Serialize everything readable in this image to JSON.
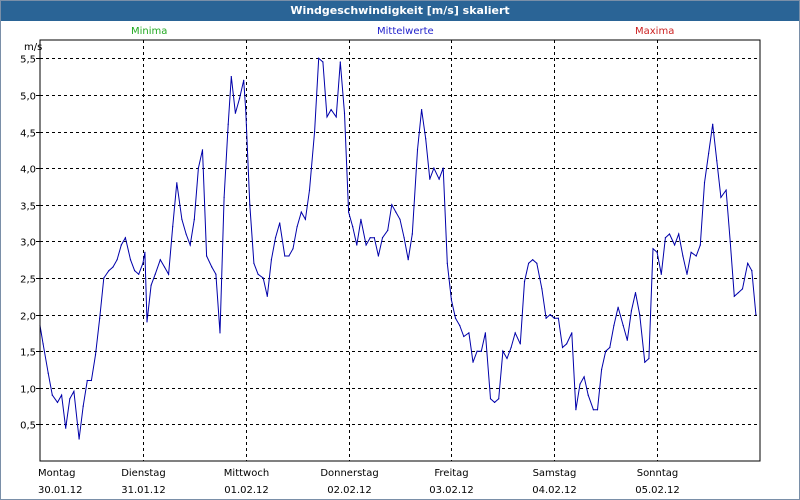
{
  "window": {
    "title": "Windgeschwindigkeit [m/s] skaliert"
  },
  "legend": {
    "minima": "Minima",
    "mittelwerte": "Mittelwerte",
    "maxima": "Maxima"
  },
  "colors": {
    "title_bar": "#2a6496",
    "minima": "#22aa22",
    "mittelwerte": "#2222cc",
    "maxima": "#cc2222",
    "series_line": "#0000aa",
    "grid": "#000000"
  },
  "chart_data": {
    "type": "line",
    "title": "Windgeschwindigkeit [m/s] skaliert",
    "ylabel": "m/s",
    "ylim": [
      0,
      5.75
    ],
    "yticks": [
      "0,5",
      "1,0",
      "1,5",
      "2,0",
      "2,5",
      "3,0",
      "3,5",
      "4,0",
      "4,5",
      "5,0",
      "5,5"
    ],
    "ytick_values": [
      0.5,
      1.0,
      1.5,
      2.0,
      2.5,
      3.0,
      3.5,
      4.0,
      4.5,
      5.0,
      5.5
    ],
    "xlim": [
      0,
      7
    ],
    "days": [
      {
        "weekday": "Montag",
        "date": "30.01.12"
      },
      {
        "weekday": "Dienstag",
        "date": "31.01.12"
      },
      {
        "weekday": "Mittwoch",
        "date": "01.02.12"
      },
      {
        "weekday": "Donnerstag",
        "date": "02.02.12"
      },
      {
        "weekday": "Freitag",
        "date": "03.02.12"
      },
      {
        "weekday": "Samstag",
        "date": "04.02.12"
      },
      {
        "weekday": "Sonntag",
        "date": "05.02.12"
      }
    ],
    "grid": true,
    "grid_style": "dashed",
    "series": [
      {
        "name": "Mittelwerte",
        "color": "#0000aa",
        "x_unit": "days since 30.01.12 00:00",
        "points": [
          [
            0.0,
            1.85
          ],
          [
            0.03,
            1.6
          ],
          [
            0.08,
            1.2
          ],
          [
            0.12,
            0.9
          ],
          [
            0.17,
            0.8
          ],
          [
            0.21,
            0.9
          ],
          [
            0.25,
            0.45
          ],
          [
            0.29,
            0.85
          ],
          [
            0.33,
            0.95
          ],
          [
            0.38,
            0.3
          ],
          [
            0.42,
            0.75
          ],
          [
            0.46,
            1.1
          ],
          [
            0.5,
            1.1
          ],
          [
            0.54,
            1.45
          ],
          [
            0.58,
            1.95
          ],
          [
            0.62,
            2.5
          ],
          [
            0.67,
            2.6
          ],
          [
            0.71,
            2.65
          ],
          [
            0.75,
            2.75
          ],
          [
            0.79,
            2.95
          ],
          [
            0.83,
            3.05
          ],
          [
            0.88,
            2.75
          ],
          [
            0.92,
            2.6
          ],
          [
            0.96,
            2.55
          ],
          [
            1.0,
            2.7
          ],
          [
            1.02,
            2.85
          ],
          [
            1.04,
            1.9
          ],
          [
            1.08,
            2.4
          ],
          [
            1.12,
            2.55
          ],
          [
            1.17,
            2.75
          ],
          [
            1.21,
            2.65
          ],
          [
            1.25,
            2.55
          ],
          [
            1.29,
            3.2
          ],
          [
            1.33,
            3.8
          ],
          [
            1.38,
            3.3
          ],
          [
            1.42,
            3.1
          ],
          [
            1.46,
            2.95
          ],
          [
            1.5,
            3.3
          ],
          [
            1.54,
            4.0
          ],
          [
            1.58,
            4.25
          ],
          [
            1.62,
            2.8
          ],
          [
            1.67,
            2.65
          ],
          [
            1.71,
            2.55
          ],
          [
            1.75,
            1.75
          ],
          [
            1.79,
            3.6
          ],
          [
            1.83,
            4.6
          ],
          [
            1.86,
            5.25
          ],
          [
            1.9,
            4.75
          ],
          [
            1.94,
            4.95
          ],
          [
            1.98,
            5.2
          ],
          [
            2.0,
            4.8
          ],
          [
            2.04,
            3.5
          ],
          [
            2.08,
            2.7
          ],
          [
            2.12,
            2.55
          ],
          [
            2.17,
            2.5
          ],
          [
            2.21,
            2.25
          ],
          [
            2.25,
            2.75
          ],
          [
            2.29,
            3.05
          ],
          [
            2.33,
            3.25
          ],
          [
            2.38,
            2.8
          ],
          [
            2.42,
            2.8
          ],
          [
            2.46,
            2.9
          ],
          [
            2.5,
            3.2
          ],
          [
            2.54,
            3.4
          ],
          [
            2.58,
            3.3
          ],
          [
            2.62,
            3.7
          ],
          [
            2.67,
            4.5
          ],
          [
            2.71,
            5.5
          ],
          [
            2.75,
            5.45
          ],
          [
            2.79,
            4.7
          ],
          [
            2.83,
            4.8
          ],
          [
            2.88,
            4.7
          ],
          [
            2.92,
            5.45
          ],
          [
            2.96,
            4.75
          ],
          [
            3.0,
            3.4
          ],
          [
            3.04,
            3.2
          ],
          [
            3.08,
            2.95
          ],
          [
            3.12,
            3.3
          ],
          [
            3.17,
            2.95
          ],
          [
            3.21,
            3.05
          ],
          [
            3.25,
            3.05
          ],
          [
            3.29,
            2.8
          ],
          [
            3.33,
            3.05
          ],
          [
            3.38,
            3.15
          ],
          [
            3.42,
            3.5
          ],
          [
            3.46,
            3.4
          ],
          [
            3.5,
            3.3
          ],
          [
            3.54,
            3.05
          ],
          [
            3.58,
            2.75
          ],
          [
            3.62,
            3.1
          ],
          [
            3.67,
            4.25
          ],
          [
            3.71,
            4.8
          ],
          [
            3.75,
            4.4
          ],
          [
            3.79,
            3.85
          ],
          [
            3.83,
            4.0
          ],
          [
            3.88,
            3.85
          ],
          [
            3.92,
            4.0
          ],
          [
            3.96,
            2.7
          ],
          [
            4.0,
            2.2
          ],
          [
            4.04,
            1.95
          ],
          [
            4.08,
            1.85
          ],
          [
            4.12,
            1.7
          ],
          [
            4.17,
            1.75
          ],
          [
            4.21,
            1.35
          ],
          [
            4.25,
            1.5
          ],
          [
            4.29,
            1.5
          ],
          [
            4.33,
            1.75
          ],
          [
            4.38,
            0.85
          ],
          [
            4.42,
            0.8
          ],
          [
            4.46,
            0.85
          ],
          [
            4.5,
            1.5
          ],
          [
            4.54,
            1.4
          ],
          [
            4.58,
            1.55
          ],
          [
            4.62,
            1.75
          ],
          [
            4.67,
            1.6
          ],
          [
            4.71,
            2.45
          ],
          [
            4.75,
            2.7
          ],
          [
            4.79,
            2.75
          ],
          [
            4.83,
            2.7
          ],
          [
            4.88,
            2.35
          ],
          [
            4.92,
            1.95
          ],
          [
            4.96,
            2.0
          ],
          [
            5.0,
            1.95
          ],
          [
            5.04,
            1.95
          ],
          [
            5.08,
            1.55
          ],
          [
            5.12,
            1.6
          ],
          [
            5.17,
            1.75
          ],
          [
            5.21,
            0.7
          ],
          [
            5.25,
            1.05
          ],
          [
            5.29,
            1.15
          ],
          [
            5.33,
            0.9
          ],
          [
            5.38,
            0.7
          ],
          [
            5.42,
            0.7
          ],
          [
            5.46,
            1.25
          ],
          [
            5.5,
            1.5
          ],
          [
            5.54,
            1.55
          ],
          [
            5.58,
            1.85
          ],
          [
            5.62,
            2.1
          ],
          [
            5.67,
            1.85
          ],
          [
            5.71,
            1.65
          ],
          [
            5.75,
            2.05
          ],
          [
            5.79,
            2.3
          ],
          [
            5.83,
            2.0
          ],
          [
            5.88,
            1.35
          ],
          [
            5.92,
            1.4
          ],
          [
            5.96,
            2.9
          ],
          [
            6.0,
            2.85
          ],
          [
            6.04,
            2.55
          ],
          [
            6.08,
            3.05
          ],
          [
            6.12,
            3.1
          ],
          [
            6.17,
            2.95
          ],
          [
            6.21,
            3.1
          ],
          [
            6.25,
            2.8
          ],
          [
            6.29,
            2.55
          ],
          [
            6.33,
            2.85
          ],
          [
            6.38,
            2.8
          ],
          [
            6.42,
            2.95
          ],
          [
            6.46,
            3.8
          ],
          [
            6.5,
            4.2
          ],
          [
            6.54,
            4.6
          ],
          [
            6.58,
            4.1
          ],
          [
            6.62,
            3.6
          ],
          [
            6.67,
            3.7
          ],
          [
            6.71,
            3.0
          ],
          [
            6.75,
            2.25
          ],
          [
            6.79,
            2.3
          ],
          [
            6.83,
            2.35
          ],
          [
            6.88,
            2.7
          ],
          [
            6.92,
            2.6
          ],
          [
            6.96,
            2.0
          ]
        ]
      }
    ]
  }
}
